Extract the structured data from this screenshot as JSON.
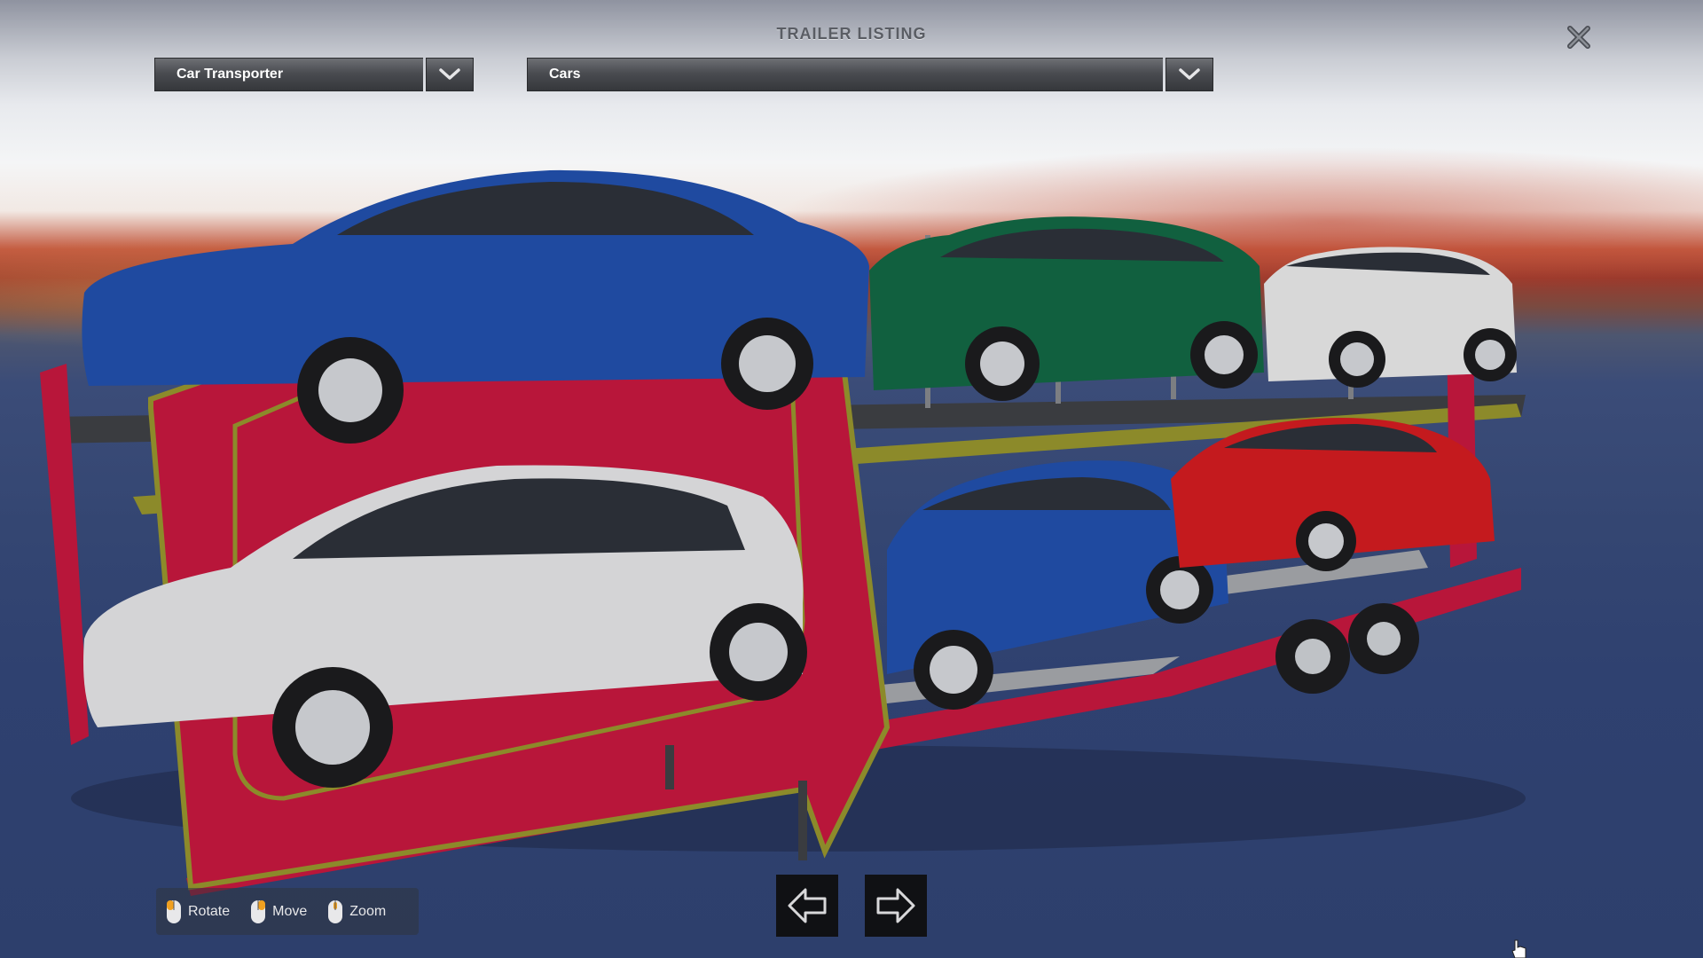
{
  "header": {
    "title": "TRAILER LISTING"
  },
  "filters": {
    "trailer_type": {
      "selected": "Car Transporter"
    },
    "cargo": {
      "selected": "Cars"
    }
  },
  "controls": {
    "rotate_label": "Rotate",
    "move_label": "Move",
    "zoom_label": "Zoom"
  },
  "icons": {
    "close": "close-icon",
    "dropdown": "chevron-down-icon",
    "prev": "arrow-left-icon",
    "next": "arrow-right-icon",
    "mouse": "mouse-icon",
    "cursor": "hand-cursor-icon"
  },
  "colors": {
    "trailer_red": "#b8163a",
    "trim_olive": "#8c8a2a",
    "car_blue": "#1f4aa0",
    "car_green": "#11603f",
    "car_white": "#d8d8d8",
    "car_red": "#c41a1e",
    "panel_dark": "#101114"
  }
}
